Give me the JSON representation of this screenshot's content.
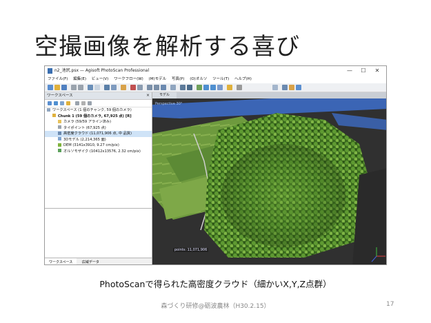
{
  "slide": {
    "title": "空撮画像を解析する喜び",
    "caption": "PhotoScanで得られた高密度クラウド（細かいX,Y,Z点群）",
    "footer": "森づくり研修@砺波農林（H30.2.15）",
    "page_number": "17"
  },
  "window": {
    "title": "n2_池尻.psx — Agisoft PhotoScan Professional",
    "controls": [
      "—",
      "☐",
      "✕"
    ]
  },
  "menu": [
    "ファイル(F)",
    "編集(E)",
    "ビュー(V)",
    "ワークフロー(W)",
    "(M)モデル",
    "写真(P)",
    "(O)オルソ",
    "ツール(T)",
    "ヘルプ(H)"
  ],
  "workspace": {
    "header": "ワークスペース",
    "close": "×",
    "tree": [
      {
        "label": "ワークスペース (1 個のチャンク, 59 個のカメラ)",
        "indent": 0,
        "icon": "workspace-icon",
        "bold": false
      },
      {
        "label": "Chunk 1 (59 個のカメラ, 67,925 点) [R]",
        "indent": 1,
        "icon": "chunk-icon",
        "bold": true
      },
      {
        "label": "カメラ (59/59 アライン済み)",
        "indent": 2,
        "icon": "camera-folder-icon",
        "bold": false
      },
      {
        "label": "タイポイント (67,925 点)",
        "indent": 2,
        "icon": "tie-points-icon",
        "bold": false
      },
      {
        "label": "高密度クラウド (11,071,906 点, 中 品質)",
        "indent": 2,
        "icon": "dense-cloud-icon",
        "bold": false,
        "selected": true
      },
      {
        "label": "3Dモデル (2,214,365 面)",
        "indent": 2,
        "icon": "mesh-icon",
        "bold": false
      },
      {
        "label": "DEM (3141x3910, 9.27 cm/pix)",
        "indent": 2,
        "icon": "dem-icon",
        "bold": false
      },
      {
        "label": "オルソモザイク (10412x13576, 2.32 cm/pix)",
        "indent": 2,
        "icon": "orthomosaic-icon",
        "bold": false
      }
    ],
    "tabs": [
      "ワークスペース",
      "広域データ"
    ]
  },
  "viewport": {
    "tab": "モデル",
    "projection": "Perspective 30°",
    "points_readout": "points: 11,071,906"
  },
  "colors": {
    "accent": "#3b6fb0",
    "selection": "#cfe3f7",
    "forest_dark": "#2f5a1a",
    "forest_light": "#7fb33c",
    "river": "#3d6cc4"
  }
}
